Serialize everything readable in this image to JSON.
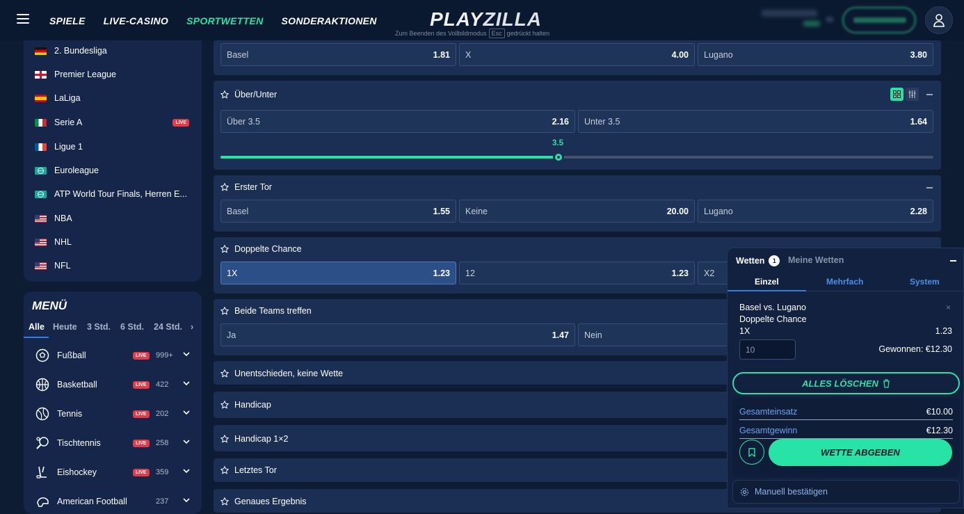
{
  "nav": {
    "items": [
      "SPIELE",
      "LIVE-CASINO",
      "SPORTWETTEN",
      "SONDERAKTIONEN"
    ],
    "active": "SPORTWETTEN"
  },
  "logo": {
    "part1": "PLAY",
    "part2": "ZILLA"
  },
  "fullscreen_note": {
    "before": "Zum Beenden des Vollbildmodus",
    "key": "Esc",
    "after": "gedrückt halten"
  },
  "leagues": [
    {
      "name": "2. Bundesliga",
      "flag": "germany"
    },
    {
      "name": "Premier League",
      "flag": "england"
    },
    {
      "name": "LaLiga",
      "flag": "spain"
    },
    {
      "name": "Serie A",
      "flag": "italy",
      "live": "LIVE"
    },
    {
      "name": "Ligue 1",
      "flag": "france"
    },
    {
      "name": "Euroleague",
      "flag": "world"
    },
    {
      "name": "ATP World Tour Finals, Herren E...",
      "flag": "world"
    },
    {
      "name": "NBA",
      "flag": "usa"
    },
    {
      "name": "NHL",
      "flag": "usa"
    },
    {
      "name": "NFL",
      "flag": "usa"
    }
  ],
  "menu": {
    "title": "MENÜ",
    "tabs": [
      "Alle",
      "Heute",
      "3 Std.",
      "6 Std.",
      "24 Std."
    ],
    "sports": [
      {
        "name": "Fußball",
        "live": "LIVE",
        "count": "999+",
        "icon": "soccer-ball-icon"
      },
      {
        "name": "Basketball",
        "live": "LIVE",
        "count": "422",
        "icon": "basketball-icon"
      },
      {
        "name": "Tennis",
        "live": "LIVE",
        "count": "202",
        "icon": "tennis-ball-icon"
      },
      {
        "name": "Tischtennis",
        "live": "LIVE",
        "count": "258",
        "icon": "table-tennis-icon"
      },
      {
        "name": "Eishockey",
        "live": "LIVE",
        "count": "359",
        "icon": "hockey-stick-icon"
      },
      {
        "name": "American Football",
        "live": "",
        "count": "237",
        "icon": "football-helmet-icon"
      }
    ]
  },
  "markets": {
    "match_result": {
      "odds": [
        {
          "label": "Basel",
          "value": "1.81"
        },
        {
          "label": "X",
          "value": "4.00"
        },
        {
          "label": "Lugano",
          "value": "3.80"
        }
      ]
    },
    "over_under": {
      "title": "Über/Unter",
      "odds": [
        {
          "label": "Über 3.5",
          "value": "2.16"
        },
        {
          "label": "Unter 3.5",
          "value": "1.64"
        }
      ],
      "slider_value": "3.5",
      "slider_fraction": 0.474
    },
    "first_goal": {
      "title": "Erster Tor",
      "odds": [
        {
          "label": "Basel",
          "value": "1.55"
        },
        {
          "label": "Keine",
          "value": "20.00"
        },
        {
          "label": "Lugano",
          "value": "2.28"
        }
      ]
    },
    "double_chance": {
      "title": "Doppelte Chance",
      "odds": [
        {
          "label": "1X",
          "value": "1.23"
        },
        {
          "label": "12",
          "value": "1.23"
        },
        {
          "label": "X2",
          "value": ""
        }
      ]
    },
    "both_score": {
      "title": "Beide Teams treffen",
      "odds": [
        {
          "label": "Ja",
          "value": "1.47"
        },
        {
          "label": "Nein",
          "value": ""
        }
      ]
    },
    "collapsed": [
      "Unentschieden, keine Wette",
      "Handicap",
      "Handicap 1×2",
      "Letztes Tor",
      "Genaues Ergebnis"
    ]
  },
  "betslip": {
    "title": "Wetten",
    "count": "1",
    "my_bets": "Meine Wetten",
    "tabs": [
      "Einzel",
      "Mehrfach",
      "System"
    ],
    "match": "Basel vs. Lugano",
    "market": "Doppelte Chance",
    "selection": "1X",
    "odd": "1.23",
    "stake": "10",
    "win_label": "Gewonnen: €12.30",
    "clear_label": "ALLES LÖSCHEN",
    "total_stake_label": "Gesamteinsatz",
    "total_stake": "€10.00",
    "total_win_label": "Gesamtgewinn",
    "total_win": "€12.30",
    "place_label": "WETTE ABGEBEN",
    "manual_label": "Manuell bestätigen"
  },
  "colors": {
    "accent": "#27e3a6",
    "live": "#e53946",
    "bg": "#0d1c33",
    "panel": "#15264a",
    "market": "#1b2f54"
  }
}
